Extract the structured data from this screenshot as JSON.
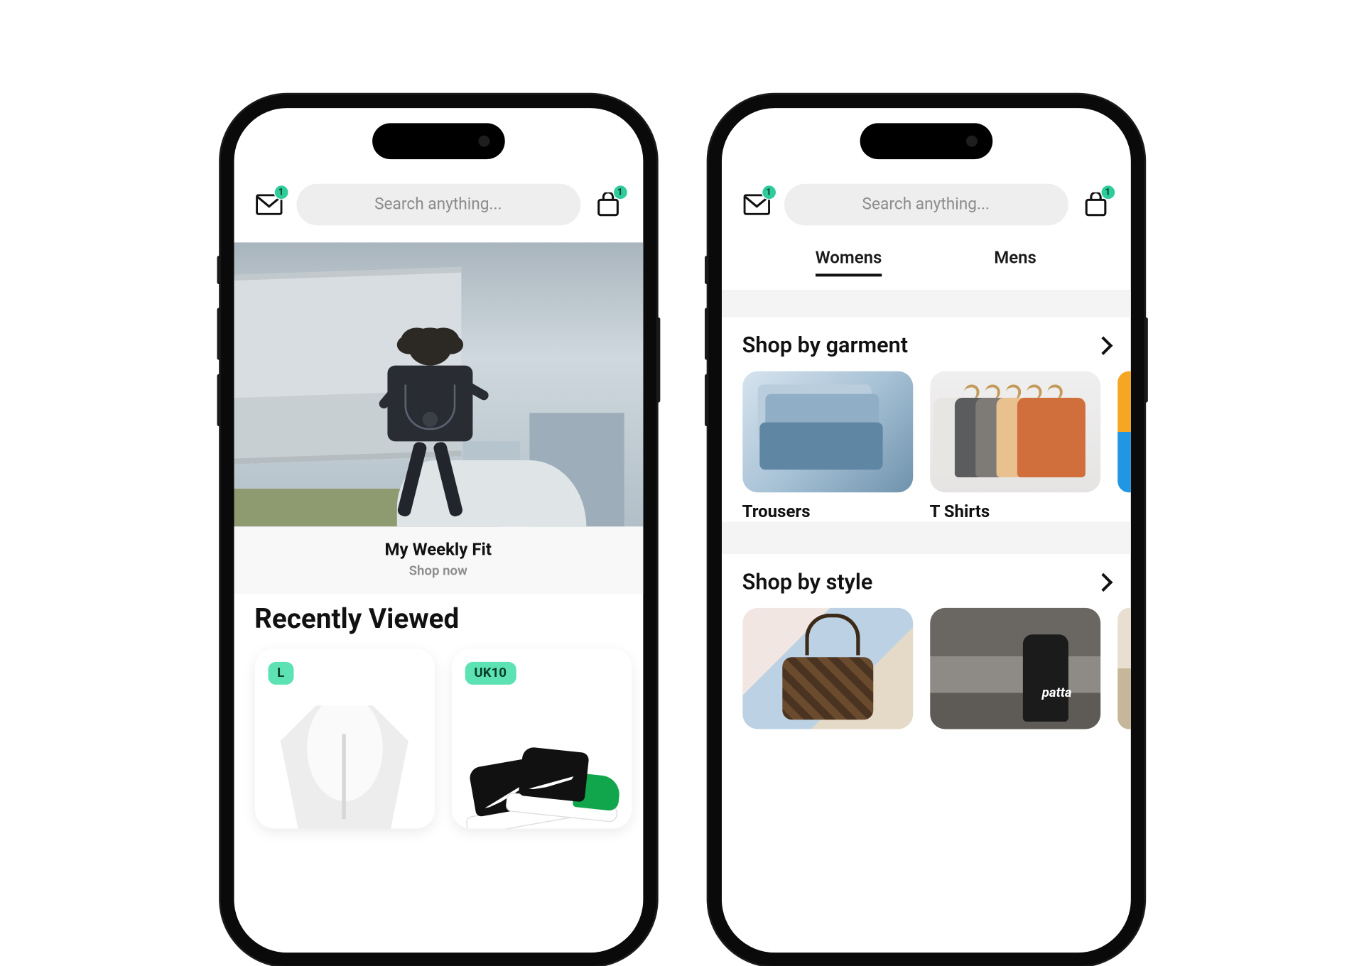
{
  "header": {
    "search_placeholder": "Search anything...",
    "mail_badge": "1",
    "bag_badge": "1"
  },
  "phone_left": {
    "hero_title": "My Weekly Fit",
    "hero_cta": "Shop now",
    "recent_title": "Recently Viewed",
    "recent_items": [
      {
        "size": "L"
      },
      {
        "size": "UK10"
      }
    ]
  },
  "phone_right": {
    "tabs": {
      "womens": "Womens",
      "mens": "Mens",
      "active": "womens"
    },
    "garment": {
      "title": "Shop by garment",
      "items": [
        {
          "label": "Trousers"
        },
        {
          "label": "T Shirts"
        }
      ]
    },
    "style": {
      "title": "Shop by style"
    }
  }
}
